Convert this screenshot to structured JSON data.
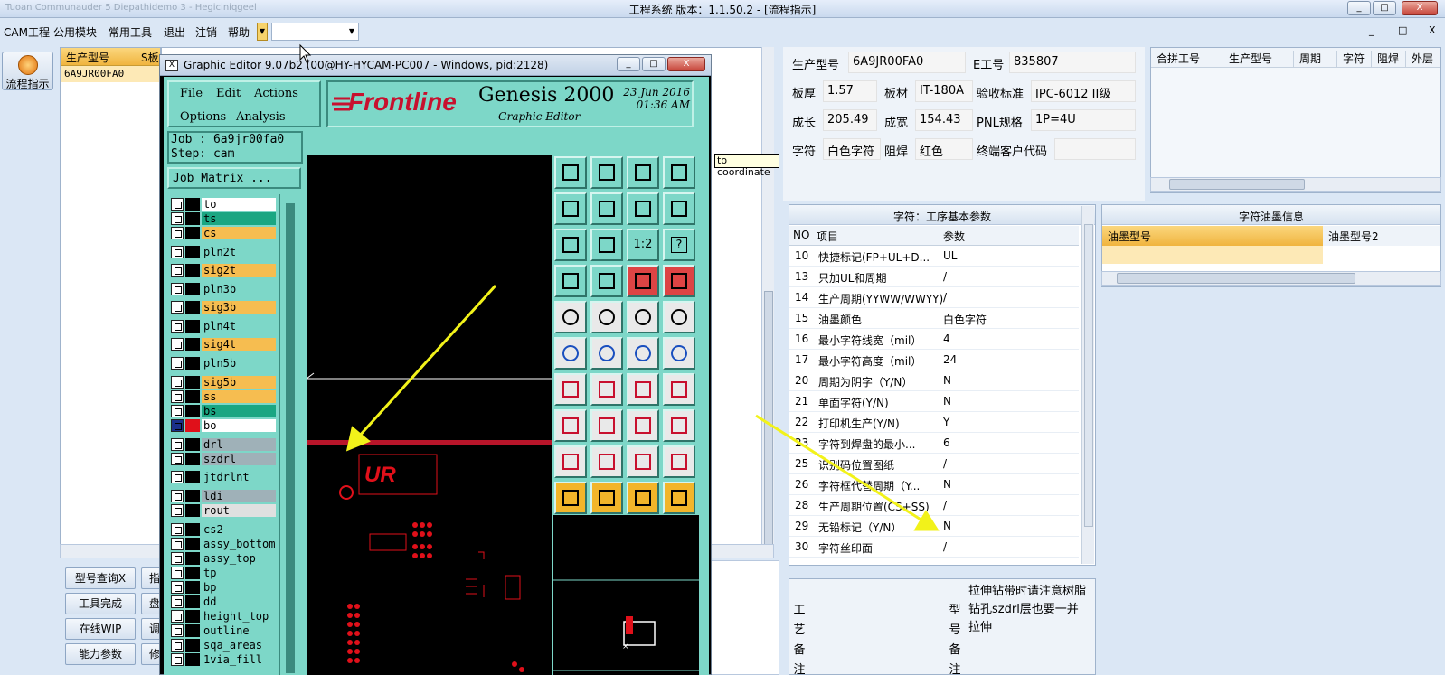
{
  "window": {
    "title": "工程系统   版本：1.1.50.2 - [流程指示]",
    "ghost_text": "Tuoan Communauder 5 Diepathidemo 3 - Hegiciniqgeel",
    "min": "_",
    "max": "□",
    "close": "X"
  },
  "menu": {
    "items": [
      "CAM工程",
      "公用模块",
      "常用工具",
      "退出",
      "注销",
      "帮助"
    ],
    "dropdown_glyph": "▼",
    "combo_value": "▼",
    "mdi_controls": [
      "_",
      "□",
      "X"
    ]
  },
  "nav": {
    "flow_button": "流程指示"
  },
  "left_grid": {
    "headers": [
      "生产型号",
      "S板"
    ],
    "rows": [
      [
        "6A9JR00FA0"
      ]
    ]
  },
  "bottom_buttons": [
    "型号查询X",
    "工具完成",
    "在线WIP",
    "能力参数"
  ],
  "bottom_buttons_clipped": [
    "指",
    "盘",
    "调",
    "修"
  ],
  "info": {
    "rows": [
      [
        {
          "label": "生产型号",
          "value": "6A9JR00FA0"
        },
        {
          "label": "E工号",
          "value": "835807"
        }
      ],
      [
        {
          "label": "板厚",
          "value": "1.57"
        },
        {
          "label": "板材",
          "value": "IT-180A"
        },
        {
          "label": "验收标准",
          "value": "IPC-6012 II级"
        }
      ],
      [
        {
          "label": "成长",
          "value": "205.49"
        },
        {
          "label": "成宽",
          "value": "154.43"
        },
        {
          "label": "PNL规格",
          "value": "1P=4U"
        }
      ],
      [
        {
          "label": "字符",
          "value": "白色字符"
        },
        {
          "label": "阻焊",
          "value": "红色"
        },
        {
          "label": "终端客户代码",
          "value": ""
        }
      ]
    ]
  },
  "merge_grid": {
    "headers": [
      "合拼工号",
      "生产型号",
      "周期",
      "字符",
      "阻焊",
      "外层"
    ]
  },
  "params": {
    "caption": "字符：工序基本参数",
    "headers": [
      "NO",
      "项目",
      "参数"
    ],
    "rows": [
      [
        "10",
        "快捷标记(FP+UL+D...",
        "UL"
      ],
      [
        "13",
        "只加UL和周期",
        "/"
      ],
      [
        "14",
        "生产周期(YYWW/WWYY)",
        "/"
      ],
      [
        "15",
        "油墨颜色",
        "白色字符"
      ],
      [
        "16",
        "最小字符线宽（mil）",
        "4"
      ],
      [
        "17",
        "最小字符高度（mil）",
        "24"
      ],
      [
        "20",
        "周期为阴字（Y/N）",
        "N"
      ],
      [
        "21",
        "单面字符(Y/N)",
        "N"
      ],
      [
        "22",
        "打印机生产(Y/N)",
        "Y"
      ],
      [
        "23",
        "字符到焊盘的最小...",
        "6"
      ],
      [
        "25",
        "识别码位置图纸",
        "/"
      ],
      [
        "26",
        "字符框代替周期（Y...",
        "N"
      ],
      [
        "28",
        "生产周期位置(CS+SS)",
        "/"
      ],
      [
        "29",
        "无铅标记（Y/N）",
        "N"
      ],
      [
        "30",
        "字符丝印面",
        "/"
      ]
    ]
  },
  "ink": {
    "caption": "字符油墨信息",
    "headers": [
      "油墨型号",
      "油墨型号2"
    ]
  },
  "notes": {
    "process_label": [
      "工",
      "艺",
      "备",
      "注"
    ],
    "model_label": [
      "型",
      "号",
      "备",
      "注"
    ],
    "model_note": "拉伸钻带时请注意树脂钻孔szdrl层也要一并拉伸"
  },
  "tooltip": "to coordinate",
  "graphic_editor": {
    "title": "Graphic Editor 9.07b2 (00@HY-HYCAM-PC007 - Windows, pid:2128)",
    "icon": "X",
    "menu": [
      "File",
      "Edit",
      "Actions",
      "Options",
      "Analysis"
    ],
    "logo": {
      "frontline": "Frontline",
      "genesis": "Genesis 2000",
      "subtitle": "Graphic Editor",
      "date": "23 Jun 2016",
      "time": "01:36 AM"
    },
    "job": "Job : 6a9jr00fa0",
    "step": "Step: cam",
    "job_matrix": "Job Matrix ...",
    "layers": [
      {
        "name": "to",
        "color": "#ffffff"
      },
      {
        "name": "ts",
        "color": "#1aa682"
      },
      {
        "name": "cs",
        "color": "#f6bd50"
      },
      {
        "name": "pln2t",
        "color": "#7dd7c8"
      },
      {
        "name": "sig2t",
        "color": "#f6bd50"
      },
      {
        "name": "pln3b",
        "color": "#7dd7c8"
      },
      {
        "name": "sig3b",
        "color": "#f6bd50"
      },
      {
        "name": "pln4t",
        "color": "#7dd7c8"
      },
      {
        "name": "sig4t",
        "color": "#f6bd50"
      },
      {
        "name": "pln5b",
        "color": "#7dd7c8"
      },
      {
        "name": "sig5b",
        "color": "#f6bd50"
      },
      {
        "name": "ss",
        "color": "#f6bd50"
      },
      {
        "name": "bs",
        "color": "#1aa682"
      },
      {
        "name": "bo",
        "color": "#ffffff"
      },
      {
        "name": "drl",
        "color": "#9fb1b8"
      },
      {
        "name": "szdrl",
        "color": "#9fb1b8"
      },
      {
        "name": "jtdrlnt",
        "color": "#7dd7c8"
      },
      {
        "name": "ldi",
        "color": "#9fb1b8"
      },
      {
        "name": "rout",
        "color": "#e0e0e0"
      },
      {
        "name": "cs2",
        "color": "#7dd7c8"
      },
      {
        "name": "assy_bottom",
        "color": "#7dd7c8"
      },
      {
        "name": "assy_top",
        "color": "#7dd7c8"
      },
      {
        "name": "tp",
        "color": "#7dd7c8"
      },
      {
        "name": "bp",
        "color": "#7dd7c8"
      },
      {
        "name": "dd",
        "color": "#7dd7c8"
      },
      {
        "name": "height_top",
        "color": "#7dd7c8"
      },
      {
        "name": "outline",
        "color": "#7dd7c8"
      },
      {
        "name": "sqa_areas",
        "color": "#7dd7c8"
      },
      {
        "name": "1via_fill",
        "color": "#7dd7c8"
      }
    ],
    "ratio_button": "1:2",
    "help_button": "?"
  }
}
